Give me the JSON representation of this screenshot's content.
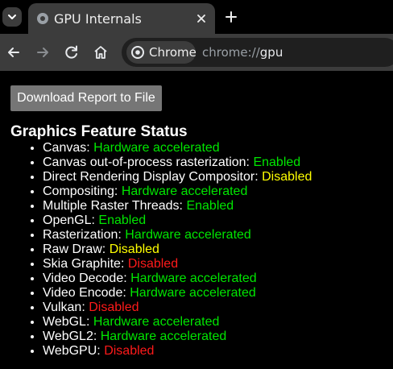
{
  "colors": {
    "enabled": "#00e600",
    "disabled_yellow": "#ffff00",
    "disabled_red": "#ff1a1a",
    "tab_bg": "#3c3c3c",
    "button_bg": "#767676"
  },
  "tabstrip": {
    "tab_title": "GPU Internals",
    "icons": {
      "tab_search": "chevron-down-icon",
      "favicon": "globe-icon",
      "close": "close-icon",
      "new_tab": "plus-icon"
    }
  },
  "toolbar": {
    "icons": {
      "back": "back-arrow-icon",
      "forward": "forward-arrow-icon",
      "reload": "reload-icon",
      "home": "home-icon"
    },
    "chip_label": "Chrome",
    "url_scheme": "chrome://",
    "url_host": "gpu"
  },
  "content": {
    "download_button_label": "Download Report to File",
    "section_title": "Graphics Feature Status",
    "features": [
      {
        "name": "Canvas:",
        "status": "Hardware accelerated",
        "level": "green"
      },
      {
        "name": "Canvas out-of-process rasterization:",
        "status": "Enabled",
        "level": "green"
      },
      {
        "name": "Direct Rendering Display Compositor:",
        "status": "Disabled",
        "level": "yellow"
      },
      {
        "name": "Compositing:",
        "status": "Hardware accelerated",
        "level": "green"
      },
      {
        "name": "Multiple Raster Threads:",
        "status": "Enabled",
        "level": "green"
      },
      {
        "name": "OpenGL:",
        "status": "Enabled",
        "level": "green"
      },
      {
        "name": "Rasterization:",
        "status": "Hardware accelerated",
        "level": "green"
      },
      {
        "name": "Raw Draw:",
        "status": "Disabled",
        "level": "yellow"
      },
      {
        "name": "Skia Graphite:",
        "status": "Disabled",
        "level": "red"
      },
      {
        "name": "Video Decode:",
        "status": "Hardware accelerated",
        "level": "green"
      },
      {
        "name": "Video Encode:",
        "status": "Hardware accelerated",
        "level": "green"
      },
      {
        "name": "Vulkan:",
        "status": "Disabled",
        "level": "red"
      },
      {
        "name": "WebGL:",
        "status": "Hardware accelerated",
        "level": "green"
      },
      {
        "name": "WebGL2:",
        "status": "Hardware accelerated",
        "level": "green"
      },
      {
        "name": "WebGPU:",
        "status": "Disabled",
        "level": "red"
      }
    ]
  }
}
